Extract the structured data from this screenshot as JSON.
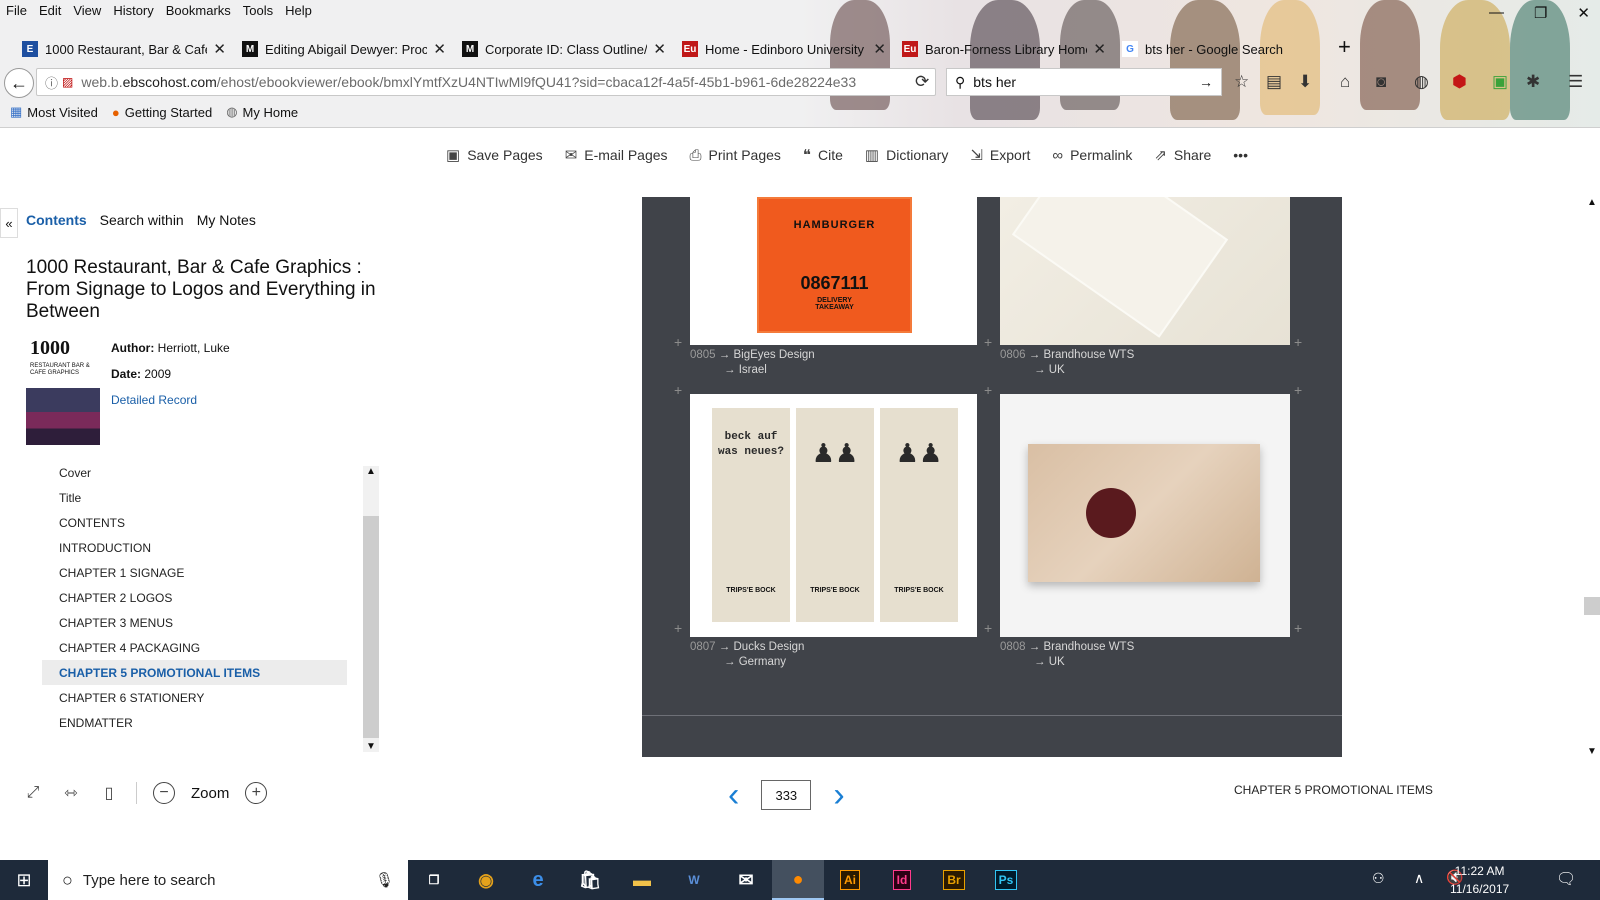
{
  "menu": [
    "File",
    "Edit",
    "View",
    "History",
    "Bookmarks",
    "Tools",
    "Help"
  ],
  "tabs": [
    {
      "label": "1000 Restaurant, Bar & Cafe",
      "fav": "E",
      "color": "#1e4fa0"
    },
    {
      "label": "Editing Abigail Dewyer: Proc",
      "fav": "M",
      "color": "#111111"
    },
    {
      "label": "Corporate ID: Class Outline/",
      "fav": "M",
      "color": "#111111"
    },
    {
      "label": "Home - Edinboro University",
      "fav": "Eu",
      "color": "#c01818"
    },
    {
      "label": "Baron-Forness Library Home",
      "fav": "Eu",
      "color": "#c01818"
    },
    {
      "label": "bts her - Google Search",
      "fav": "G",
      "color": "#4285f4"
    }
  ],
  "url": {
    "host": "web.b.",
    "domain": "ebscohost.com",
    "path": "/ehost/ebookviewer/ebook/bmxlYmtfXzU4NTIwMl9fQU41?sid=cbaca12f-4a5f-45b1-b961-6de28224e33"
  },
  "search": {
    "value": "bts her"
  },
  "bookmarks": [
    "Most Visited",
    "Getting Started",
    "My Home"
  ],
  "toolbar": [
    "Save Pages",
    "E-mail Pages",
    "Print Pages",
    "Cite",
    "Dictionary",
    "Export",
    "Permalink",
    "Share",
    "•••"
  ],
  "sidebar": {
    "tabs": [
      "Contents",
      "Search within",
      "My Notes"
    ],
    "title": "1000 Restaurant, Bar & Cafe Graphics : From Signage to Logos and Everything in Between",
    "cover_big": "1000",
    "cover_small": "RESTAURANT BAR & CAFE GRAPHICS",
    "author_label": "Author:",
    "author": "Herriott, Luke",
    "date_label": "Date:",
    "date": "2009",
    "detailed": "Detailed Record",
    "toc": [
      "Cover",
      "Title",
      "CONTENTS",
      "INTRODUCTION",
      "CHAPTER 1 SIGNAGE",
      "CHAPTER 2 LOGOS",
      "CHAPTER 3 MENUS",
      "CHAPTER 4 PACKAGING",
      "CHAPTER 5 PROMOTIONAL ITEMS",
      "CHAPTER 6 STATIONERY",
      "ENDMATTER"
    ],
    "zoom": "Zoom"
  },
  "page": {
    "items": [
      {
        "num": "0805",
        "designer": "→ BigEyes Design",
        "country": "→ Israel"
      },
      {
        "num": "0806",
        "designer": "→ Brandhouse WTS",
        "country": "→ UK"
      },
      {
        "num": "0807",
        "designer": "→ Ducks Design",
        "country": "→ Germany"
      },
      {
        "num": "0808",
        "designer": "→ Brandhouse WTS",
        "country": "→ UK"
      }
    ],
    "hamburger": "HAMBURGER",
    "phone": "0867111",
    "delivery": "DELIVERY TAKEAWAY",
    "card1": "beck auf was neues?",
    "card_brand": "TRIPS'E BOCK",
    "number": "333",
    "chapter": "CHAPTER 5 PROMOTIONAL ITEMS"
  },
  "taskbar": {
    "search": "Type here to search",
    "time": "11:22 AM",
    "date": "11/16/2017",
    "apps": [
      "Ai",
      "Id",
      "Br",
      "Ps"
    ]
  }
}
